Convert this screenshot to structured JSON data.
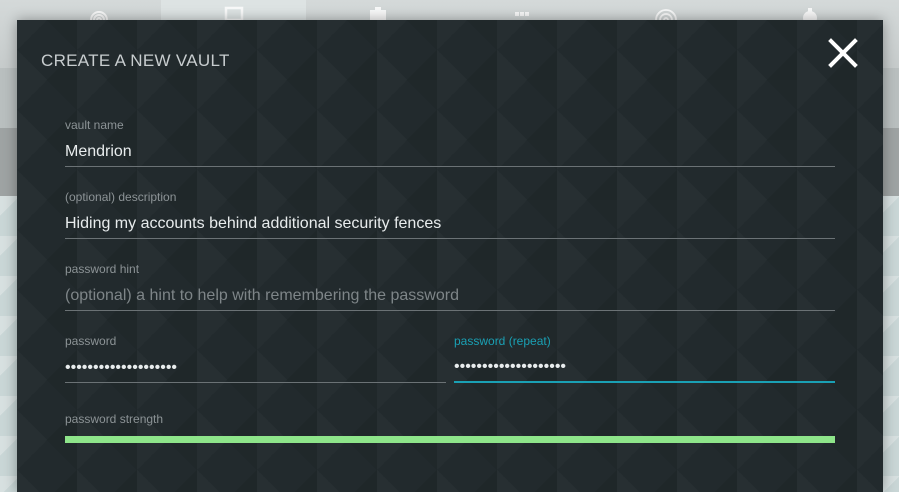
{
  "background_app": {
    "tab_icons": [
      "fingerprint-icon",
      "document-icon",
      "user-card-icon",
      "grid-icon",
      "wifi-icon",
      "gear-icon"
    ]
  },
  "dialog": {
    "title": "CREATE A NEW VAULT",
    "close_icon": "close-icon"
  },
  "form": {
    "vault_name": {
      "label": "vault name",
      "value": "Mendrion"
    },
    "description": {
      "label": "(optional) description",
      "value": "Hiding my accounts behind additional security fences"
    },
    "password_hint": {
      "label": "password hint",
      "placeholder": "(optional) a hint to help with remembering the password",
      "value": ""
    },
    "password": {
      "label": "password",
      "value": "••••••••••••••••••••"
    },
    "password_repeat": {
      "label": "password (repeat)",
      "value": "••••••••••••••••••••"
    },
    "password_strength": {
      "label": "password strength",
      "level": 1.0
    }
  },
  "colors": {
    "dialog_bg": "#222a2d",
    "accent_focus": "#1aa0b4",
    "strength_good": "#8ee58a"
  }
}
